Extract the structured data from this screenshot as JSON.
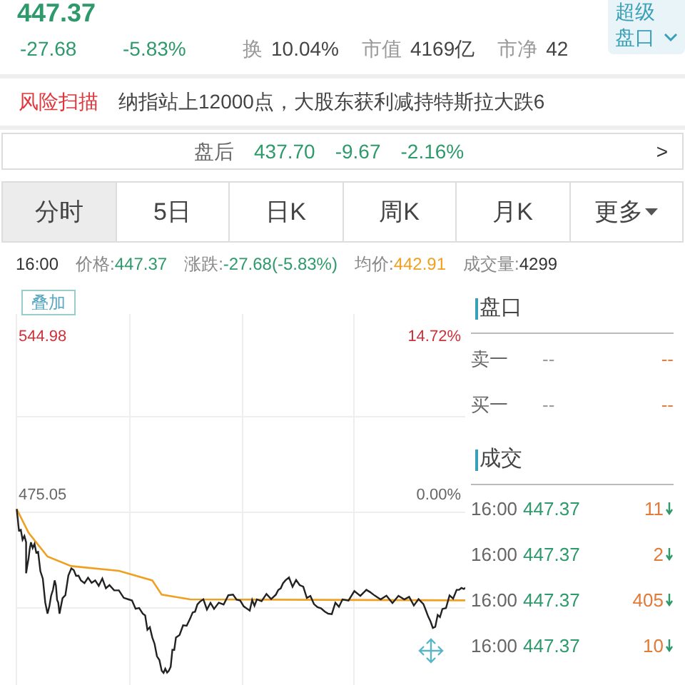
{
  "quote": {
    "price": "447.37",
    "change": "-27.68",
    "change_pct": "-5.83%",
    "stats": [
      {
        "label": "换",
        "value": "10.04%"
      },
      {
        "label": "市值",
        "value": "4169亿"
      },
      {
        "label": "市净",
        "value": "42"
      }
    ],
    "super_button": "超级盘口"
  },
  "risk": {
    "label": "风险扫描",
    "headline": "纳指站上12000点，大股东获利减持特斯拉大跌6"
  },
  "after_hours": {
    "label": "盘后",
    "price": "437.70",
    "change": "-9.67",
    "change_pct": "-2.16%",
    "arrow": ">"
  },
  "tabs": [
    {
      "label": "分时",
      "selected": true,
      "dropdown": false
    },
    {
      "label": "5日",
      "selected": false,
      "dropdown": false
    },
    {
      "label": "日K",
      "selected": false,
      "dropdown": false
    },
    {
      "label": "周K",
      "selected": false,
      "dropdown": false
    },
    {
      "label": "月K",
      "selected": false,
      "dropdown": false
    },
    {
      "label": "更多",
      "selected": false,
      "dropdown": true
    }
  ],
  "info": {
    "time": "16:00",
    "price_label": "价格:",
    "price": "447.37",
    "change_label": "涨跌:",
    "change": "-27.68(-5.83%)",
    "avg_label": "均价:",
    "avg": "442.91",
    "volume_label": "成交量:",
    "volume": "4299"
  },
  "chart": {
    "overlay_button": "叠加",
    "max_price": "544.98",
    "max_pct": "14.72%",
    "base_price": "475.05",
    "base_pct": "0.00%"
  },
  "order_book": {
    "title": "盘口",
    "rows": [
      {
        "label": "卖一",
        "price": "--",
        "volume": "--"
      },
      {
        "label": "买一",
        "price": "--",
        "volume": "--"
      }
    ]
  },
  "trades": {
    "title": "成交",
    "rows": [
      {
        "time": "16:00",
        "price": "447.37",
        "volume": "11"
      },
      {
        "time": "16:00",
        "price": "447.37",
        "volume": "2"
      },
      {
        "time": "16:00",
        "price": "447.37",
        "volume": "405"
      },
      {
        "time": "16:00",
        "price": "447.37",
        "volume": "10"
      }
    ]
  }
}
